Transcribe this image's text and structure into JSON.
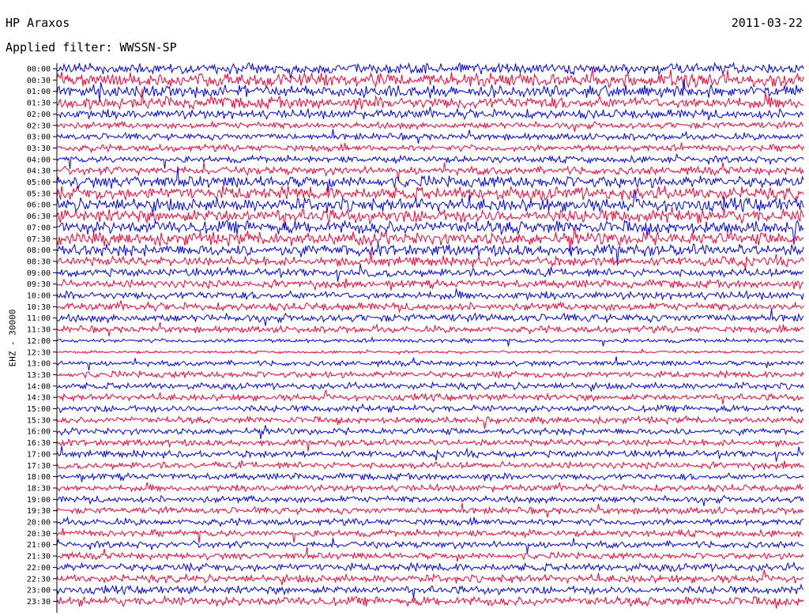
{
  "header": {
    "station": "HP Araxos",
    "filter_label": "Applied filter: WWSSN-SP",
    "date": "2011-03-22"
  },
  "chart_data": {
    "type": "line",
    "title": "HP Araxos",
    "ylabel": "EHZ - 30000",
    "row_labels": [
      "00:00",
      "00:30",
      "01:00",
      "01:30",
      "02:00",
      "02:30",
      "03:00",
      "03:30",
      "04:00",
      "04:30",
      "05:00",
      "05:30",
      "06:00",
      "06:30",
      "07:00",
      "07:30",
      "08:00",
      "08:30",
      "09:00",
      "09:30",
      "10:00",
      "10:30",
      "11:00",
      "11:30",
      "12:00",
      "12:30",
      "13:00",
      "13:30",
      "14:00",
      "14:30",
      "15:00",
      "15:30",
      "16:00",
      "16:30",
      "17:00",
      "17:30",
      "18:00",
      "18:30",
      "19:00",
      "19:30",
      "20:00",
      "20:30",
      "21:00",
      "21:30",
      "22:00",
      "22:30",
      "23:00",
      "23:30"
    ],
    "colors": [
      "#0000ff",
      "#ff0033"
    ],
    "amplitude_by_row": [
      0.8,
      1.0,
      0.9,
      0.9,
      0.7,
      0.5,
      0.5,
      0.5,
      0.5,
      0.6,
      0.9,
      1.0,
      1.0,
      1.0,
      1.0,
      1.0,
      0.9,
      0.7,
      0.6,
      0.6,
      0.6,
      0.6,
      0.6,
      0.5,
      0.3,
      0.2,
      0.4,
      0.5,
      0.5,
      0.5,
      0.5,
      0.5,
      0.5,
      0.5,
      0.5,
      0.5,
      0.5,
      0.5,
      0.5,
      0.5,
      0.5,
      0.5,
      0.5,
      0.5,
      0.6,
      0.6,
      0.6,
      0.7
    ],
    "grid": false
  }
}
